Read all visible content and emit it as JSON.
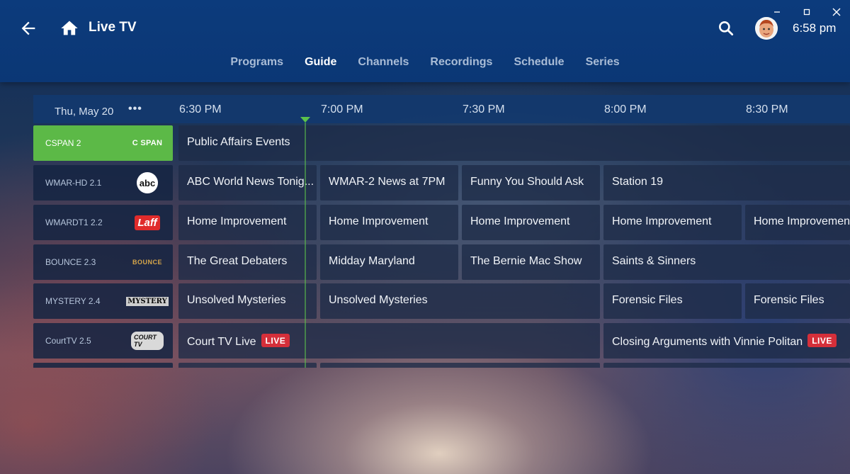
{
  "header": {
    "title": "Live TV",
    "time": "6:58 pm",
    "back_icon": "arrow-left-icon",
    "home_icon": "home-icon",
    "search_icon": "search-icon",
    "window_controls": [
      "minimize-icon",
      "maximize-icon",
      "close-icon"
    ]
  },
  "tabs": [
    {
      "label": "Programs",
      "active": false
    },
    {
      "label": "Guide",
      "active": true
    },
    {
      "label": "Channels",
      "active": false
    },
    {
      "label": "Recordings",
      "active": false
    },
    {
      "label": "Schedule",
      "active": false
    },
    {
      "label": "Series",
      "active": false
    }
  ],
  "guide": {
    "date": "Thu, May 20",
    "more_label": "•••",
    "times": [
      "6:30 PM",
      "7:00 PM",
      "7:30 PM",
      "8:00 PM",
      "8:30 PM"
    ],
    "live_label": "LIVE",
    "channels": [
      {
        "name": "CSPAN 2",
        "logo_text": "C SPAN",
        "programs": [
          "Public Affairs Events"
        ]
      },
      {
        "name": "WMAR-HD 2.1",
        "logo_text": "abc",
        "programs": [
          "ABC World News Tonig...",
          "WMAR-2 News at 7PM",
          "Funny You Should Ask",
          "Station 19"
        ]
      },
      {
        "name": "WMARDT1 2.2",
        "logo_text": "Laff",
        "programs": [
          "Home Improvement",
          "Home Improvement",
          "Home Improvement",
          "Home Improvement",
          "Home Improvemen"
        ]
      },
      {
        "name": "BOUNCE 2.3",
        "logo_text": "BOUNCE",
        "programs": [
          "The Great Debaters",
          "Midday Maryland",
          "The Bernie Mac Show",
          "Saints & Sinners"
        ]
      },
      {
        "name": "MYSTERY 2.4",
        "logo_text": "MYSTERY",
        "programs": [
          "Unsolved Mysteries",
          "Unsolved Mysteries",
          "Forensic Files",
          "Forensic Files"
        ]
      },
      {
        "name": "CourtTV 2.5",
        "logo_text": "COURT TV",
        "programs": [
          "Court TV Live",
          "Closing Arguments with Vinnie Politan"
        ]
      }
    ]
  },
  "colors": {
    "header_bg": "#0b3775",
    "selected_channel": "#5cb947",
    "live_badge": "#d52f3a",
    "now_indicator": "#5cc24b"
  }
}
